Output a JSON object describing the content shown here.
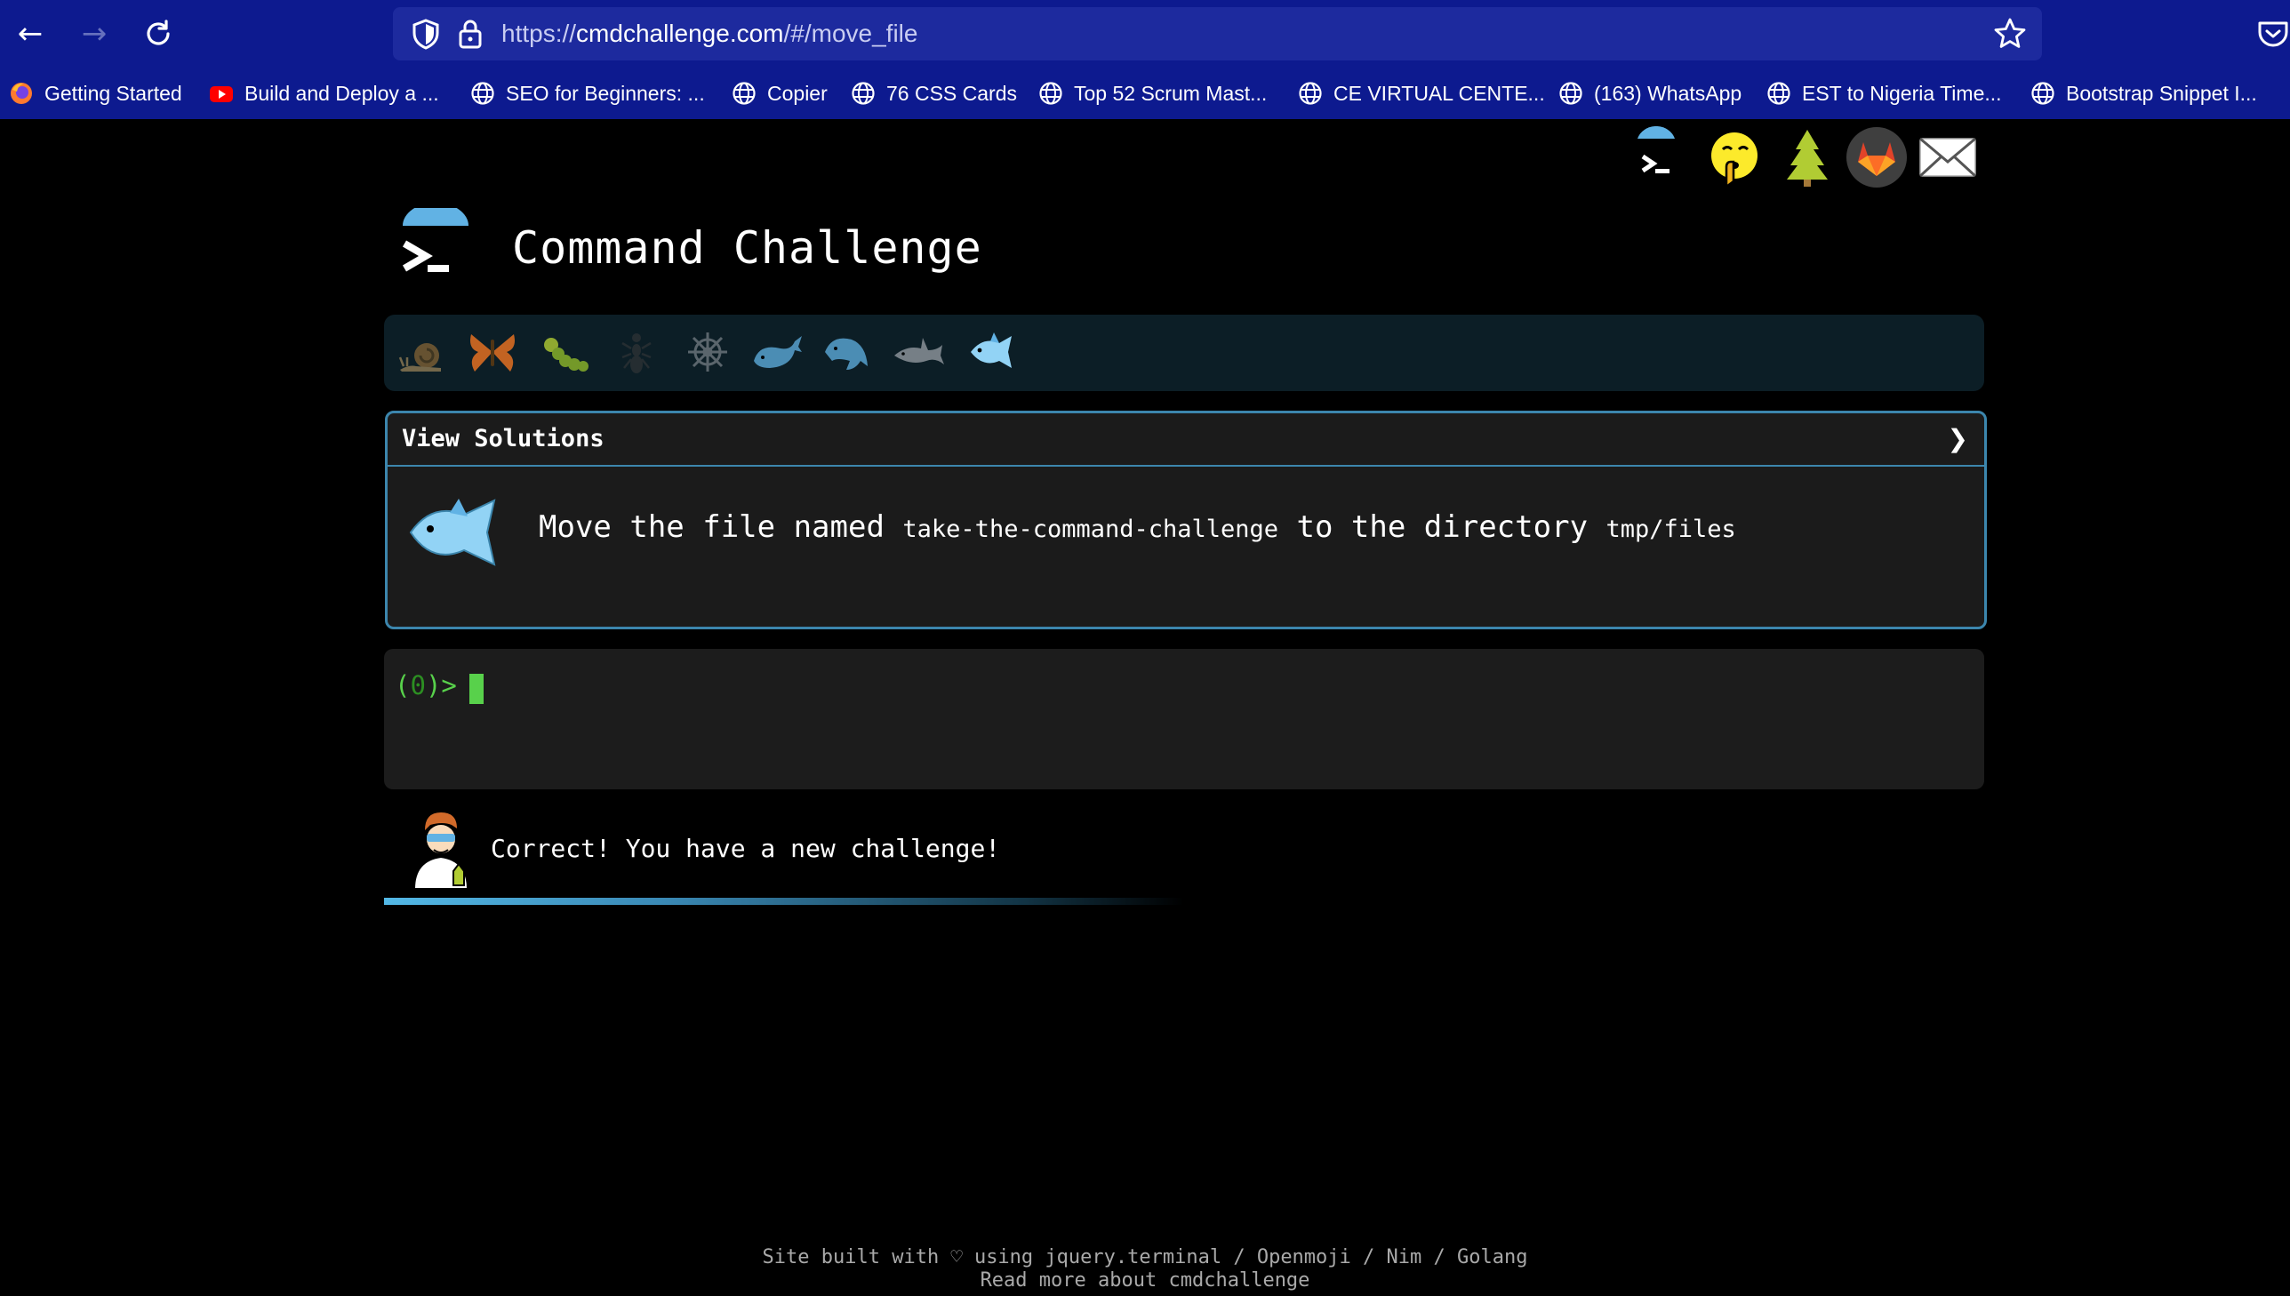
{
  "browser": {
    "url_prefix": "https://",
    "url_host": "cmdchallenge.com",
    "url_path": "/#/move_file",
    "bookmarks": [
      {
        "label": "Getting Started",
        "icon": "firefox-icon"
      },
      {
        "label": "Build and Deploy a ...",
        "icon": "youtube-icon"
      },
      {
        "label": "SEO for Beginners: ...",
        "icon": "globe-icon"
      },
      {
        "label": "Copier",
        "icon": "globe-icon"
      },
      {
        "label": "76 CSS Cards",
        "icon": "globe-icon"
      },
      {
        "label": "Top 52 Scrum Mast...",
        "icon": "globe-icon"
      },
      {
        "label": "CE VIRTUAL CENTE...",
        "icon": "globe-icon"
      },
      {
        "label": "(163) WhatsApp",
        "icon": "globe-icon"
      },
      {
        "label": "EST to Nigeria Time...",
        "icon": "globe-icon"
      },
      {
        "label": "Bootstrap Snippet I...",
        "icon": "globe-icon"
      }
    ]
  },
  "header_icons": [
    "terminal-icon",
    "shushing-face-icon",
    "tree-icon",
    "gitlab-icon",
    "envelope-icon"
  ],
  "site": {
    "title": "Command Challenge"
  },
  "levels": [
    "snail-icon",
    "butterfly-icon",
    "caterpillar-icon",
    "ant-icon",
    "helm-icon",
    "whale-icon",
    "dolphin-icon",
    "shark-icon",
    "fish-icon"
  ],
  "challenge": {
    "solutions_label": "View Solutions",
    "chevron": "❯",
    "text_before": "Move the file named ",
    "file_name": "take-the-command-challenge",
    "text_middle": " to the directory ",
    "dir_name": "tmp/files"
  },
  "terminal": {
    "prompt_open": "(",
    "prompt_count": "0",
    "prompt_close": ")>"
  },
  "status": {
    "message": "Correct! You have a new challenge!",
    "progress": 0.36
  },
  "footer": {
    "line1": "Site built with ♡ using jquery.terminal / Openmoji / Nim / Golang",
    "line2": "Read more about cmdchallenge"
  },
  "colors": {
    "chrome": "#0d1a8f",
    "accent": "#3c86ad",
    "prompt": "#58d14b"
  }
}
